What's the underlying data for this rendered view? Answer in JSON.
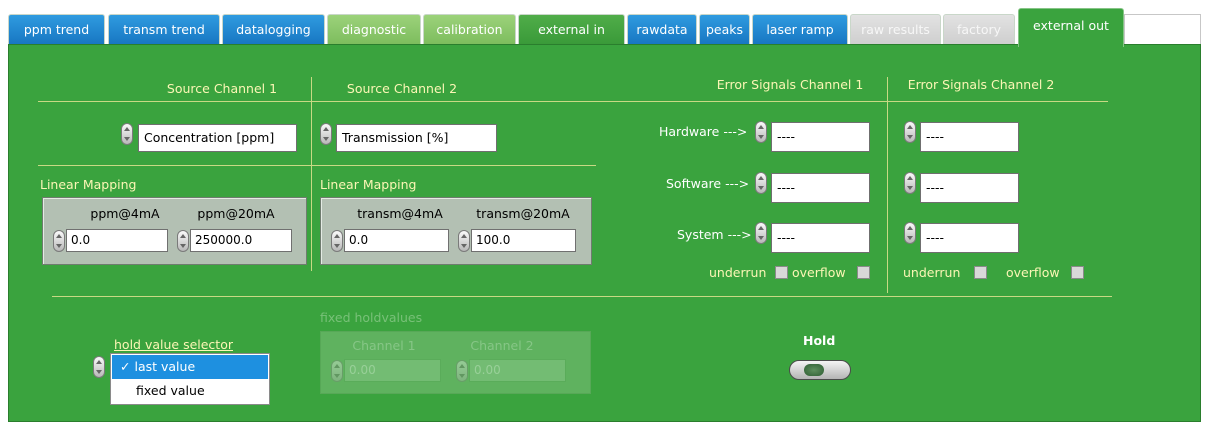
{
  "tabs": [
    {
      "label": "ppm trend",
      "style": "blue"
    },
    {
      "label": "transm trend",
      "style": "blue"
    },
    {
      "label": "datalogging",
      "style": "blue"
    },
    {
      "label": "diagnostic",
      "style": "lgreen"
    },
    {
      "label": "calibration",
      "style": "lgreen"
    },
    {
      "label": "external in",
      "style": "dgreen"
    },
    {
      "label": "rawdata",
      "style": "blue"
    },
    {
      "label": "peaks",
      "style": "blue"
    },
    {
      "label": "laser ramp",
      "style": "blue"
    },
    {
      "label": "raw results",
      "style": "gray"
    },
    {
      "label": "factory",
      "style": "gray"
    },
    {
      "label": "external out",
      "style": "active"
    }
  ],
  "source1": {
    "heading": "Source Channel 1",
    "value": "Concentration [ppm]"
  },
  "source2": {
    "heading": "Source Channel 2",
    "value": "Transmission [%]"
  },
  "mapping1": {
    "heading": "Linear Mapping",
    "low_label": "ppm@4mA",
    "high_label": "ppm@20mA",
    "low_value": "0.0",
    "high_value": "250000.0"
  },
  "mapping2": {
    "heading": "Linear Mapping",
    "low_label": "transm@4mA",
    "high_label": "transm@20mA",
    "low_value": "0.0",
    "high_value": "100.0"
  },
  "errors1": {
    "heading": "Error Signals Channel 1",
    "rows": [
      {
        "label": "Hardware --->",
        "value": "----"
      },
      {
        "label": "Software --->",
        "value": "----"
      },
      {
        "label": "System --->",
        "value": "----"
      }
    ],
    "underrun": "underrun",
    "overflow": "overflow"
  },
  "errors2": {
    "heading": "Error Signals Channel 2",
    "rows": [
      {
        "value": "----"
      },
      {
        "value": "----"
      },
      {
        "value": "----"
      }
    ],
    "underrun": "underrun",
    "overflow": "overflow"
  },
  "hold_selector": {
    "label": "hold value selector",
    "options": [
      "last value",
      "fixed value"
    ],
    "selected": "last value",
    "check": "✓"
  },
  "fixed_holdvalues": {
    "label": "fixed holdvalues",
    "ch1_label": "Channel 1",
    "ch2_label": "Channel 2",
    "ch1_value": "0.00",
    "ch2_value": "0.00"
  },
  "hold": {
    "label": "Hold"
  },
  "colors": {
    "panel": "#3aa33e",
    "label": "#fbf6b5",
    "tab_blue": "#1f86d0",
    "selected": "#1e90e0"
  }
}
